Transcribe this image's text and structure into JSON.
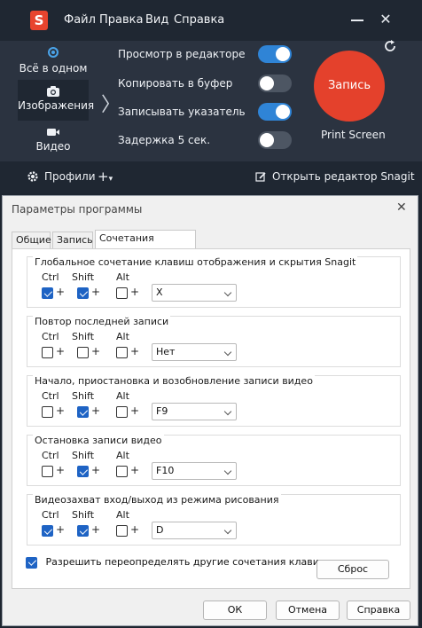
{
  "snagit": {
    "logo": "S",
    "menu": [
      "Файл",
      "Правка",
      "Вид",
      "Справка"
    ],
    "modes": [
      {
        "label": "Всё в одном",
        "icon": "radio-icon",
        "active": false
      },
      {
        "label": "Изображения",
        "icon": "camera-icon",
        "active": true
      },
      {
        "label": "Видео",
        "icon": "video-camera-icon",
        "active": false
      }
    ],
    "options": [
      {
        "label": "Просмотр в редакторе",
        "on": true
      },
      {
        "label": "Копировать в буфер",
        "on": false
      },
      {
        "label": "Записывать указатель",
        "on": true
      },
      {
        "label": "Задержка 5 сек.",
        "on": false
      }
    ],
    "capture_label": "Запись",
    "hotkey_label": "Print Screen",
    "profiles_label": "Профили",
    "add_label": "+",
    "open_editor_label": "Открыть редактор Snagit",
    "colors": {
      "accent": "#2f84d6",
      "capture": "#e4412c",
      "bg": "#2b3340"
    }
  },
  "dialog": {
    "title": "Параметры программы",
    "tabs": [
      "Общие",
      "Запись",
      "Сочетания клавиш"
    ],
    "active_tab": 2,
    "modifier_labels": {
      "ctrl": "Ctrl",
      "shift": "Shift",
      "alt": "Alt"
    },
    "plus": "+",
    "groups": [
      {
        "title": "Глобальное сочетание клавиш отображения и скрытия Snagit",
        "ctrl": true,
        "shift": true,
        "alt": false,
        "key": "X"
      },
      {
        "title": "Повтор последней записи",
        "ctrl": false,
        "shift": false,
        "alt": false,
        "key": "Нет"
      },
      {
        "title": "Начало, приостановка и возобновление записи видео",
        "ctrl": false,
        "shift": true,
        "alt": false,
        "key": "F9"
      },
      {
        "title": "Остановка записи видео",
        "ctrl": false,
        "shift": true,
        "alt": false,
        "key": "F10"
      },
      {
        "title": "Видеозахват вход/выход из режима рисования",
        "ctrl": true,
        "shift": true,
        "alt": false,
        "key": "D"
      }
    ],
    "allow_override_label": "Разрешить переопределять другие сочетания клавиш",
    "allow_override_checked": true,
    "reset_label": "Сброс",
    "ok_label": "ОК",
    "cancel_label": "Отмена",
    "help_label": "Справка"
  }
}
